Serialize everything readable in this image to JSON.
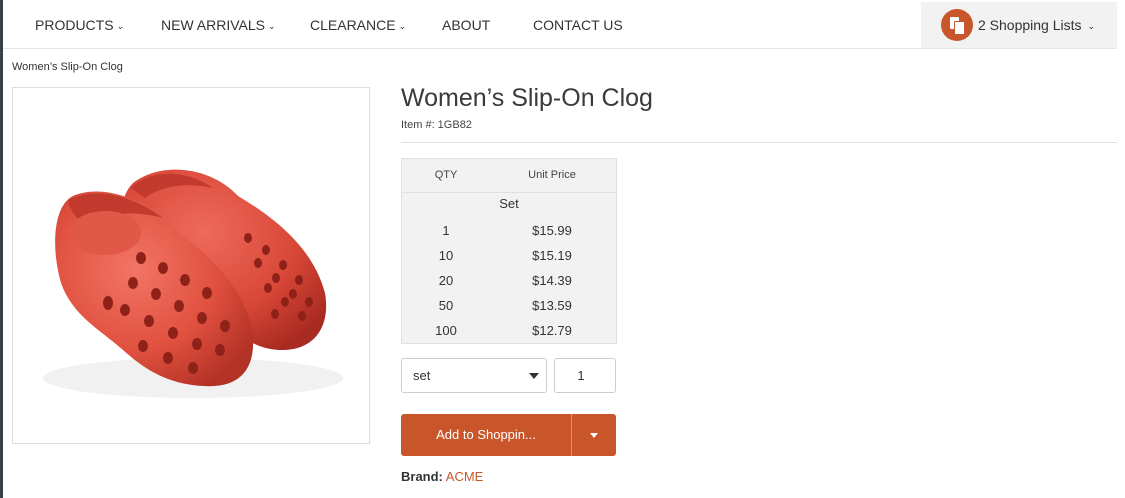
{
  "nav": {
    "items": [
      {
        "label": "PRODUCTS",
        "dropdown": true
      },
      {
        "label": "NEW ARRIVALS",
        "dropdown": true
      },
      {
        "label": "CLEARANCE",
        "dropdown": true
      },
      {
        "label": "ABOUT",
        "dropdown": false
      },
      {
        "label": "CONTACT US",
        "dropdown": false
      }
    ],
    "shopping_lists": {
      "label": "2 Shopping Lists",
      "icon": "shopping-list-icon"
    }
  },
  "breadcrumb": "Women’s Slip-On Clog",
  "product": {
    "title": "Women’s Slip-On Clog",
    "item_number": "Item #: 1GB82",
    "image": "red-slip-on-clogs",
    "brand_label": "Brand:",
    "brand": "ACME"
  },
  "price_table": {
    "headers": {
      "qty": "QTY",
      "unit_price": "Unit Price"
    },
    "unit": "Set",
    "rows": [
      {
        "qty": "1",
        "price": "$15.99"
      },
      {
        "qty": "10",
        "price": "$15.19"
      },
      {
        "qty": "20",
        "price": "$14.39"
      },
      {
        "qty": "50",
        "price": "$13.59"
      },
      {
        "qty": "100",
        "price": "$12.79"
      }
    ]
  },
  "purchase": {
    "unit_select": "set",
    "quantity": "1",
    "add_button": "Add to Shoppin..."
  },
  "colors": {
    "accent": "#c8562a",
    "table_bg": "#f2f2f2"
  }
}
